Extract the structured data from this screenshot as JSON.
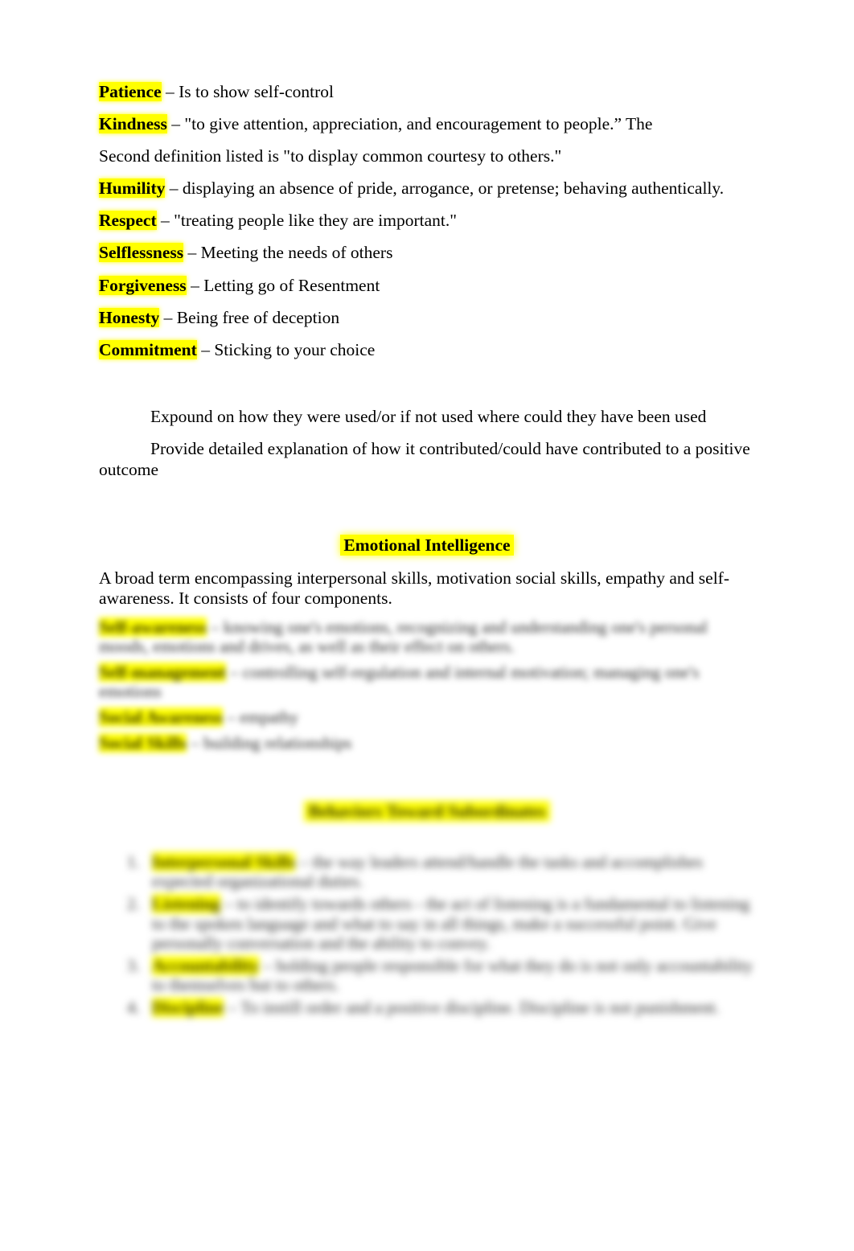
{
  "document": {
    "traits": [
      {
        "term": "Patience",
        "definition": " – Is to show self-control"
      },
      {
        "term": "Kindness",
        "definition": " – \"to give attention, appreciation, and encouragement to people.”  The"
      },
      {
        "term": "Humility",
        "definition": " – displaying an absence of pride, arrogance, or pretense; behaving authentically."
      },
      {
        "term": "Respect",
        "definition": " – \"treating people like they are important.\""
      },
      {
        "term": "Selflessness",
        "definition": " – Meeting the needs of others"
      },
      {
        "term": "Forgiveness",
        "definition": " – Letting go of Resentment"
      },
      {
        "term": "Honesty",
        "definition": " – Being free of deception"
      },
      {
        "term": "Commitment",
        "definition": " – Sticking to your choice"
      }
    ],
    "kindness_continuation": "Second definition listed is \"to display common courtesy to others.\"",
    "instructions": [
      "Expound on how they were used/or if not used where could they have been used",
      "Provide detailed explanation of how it contributed/could have contributed to a positive outcome"
    ],
    "emotional_intelligence": {
      "heading": "Emotional Intelligence",
      "intro": "A broad term encompassing interpersonal skills, motivation social skills, empathy and self-awareness. It consists of four components.",
      "components": [
        {
          "term": "Self-awareness",
          "text": " – knowing one's emotions, recognizing and understanding one's personal moods, emotions and drives, as well as their effect on others."
        },
        {
          "term": "Self-management",
          "text": " – controlling self-regulation and internal motivation; managing one's emotions"
        },
        {
          "term": "Social Awareness",
          "text": " – empathy"
        },
        {
          "term": "Social Skills",
          "text": " – building relationships"
        }
      ]
    },
    "second_section": {
      "heading": "Behaviors Toward Subordinates",
      "items": [
        {
          "term": "Interpersonal Skills",
          "text": " – the way leaders attend/handle the tasks and accomplishes expected organizational duties."
        },
        {
          "term": "Listening",
          "text": " – to identify towards others - the act of listening is a fundamental to listening to the spoken language and what to say in all things, make a successful point. Give personally conversation and the ability to convey."
        },
        {
          "term": "Accountability",
          "text": " – holding people responsible for what they do is not only accountability to themselves but to others."
        },
        {
          "term": "Discipline",
          "text": " – To instill order and a positive discipline. Discipline is not punishment."
        }
      ]
    }
  }
}
